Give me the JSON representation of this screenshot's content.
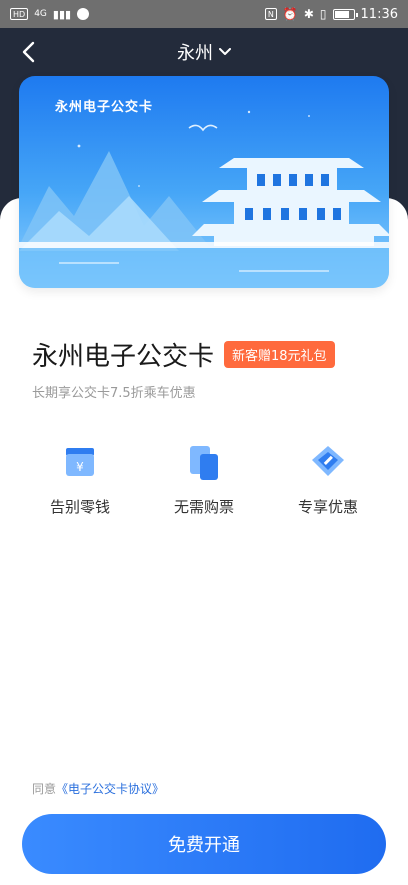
{
  "statusbar": {
    "left_badge": "HD",
    "network": "4G",
    "time": "11:36",
    "icons": [
      "nfc-icon",
      "alarm-icon",
      "bluetooth-icon",
      "vibrate-icon",
      "battery-icon"
    ]
  },
  "navbar": {
    "back_icon": "chevron-left-icon",
    "city": "永州",
    "dropdown_icon": "chevron-down-icon"
  },
  "card": {
    "title": "永州电子公交卡",
    "image": "pavilion-landscape-illustration"
  },
  "product": {
    "name": "永州电子公交卡",
    "badge": "新客赠18元礼包",
    "subtitle": "长期享公交卡7.5折乘车优惠"
  },
  "features": [
    {
      "label": "告别零钱",
      "icon": "wallet-yuan-icon"
    },
    {
      "label": "无需购票",
      "icon": "cards-icon"
    },
    {
      "label": "专享优惠",
      "icon": "coupon-tag-icon"
    }
  ],
  "agreement": {
    "prefix": "同意",
    "link": "《电子公交卡协议》"
  },
  "cta": {
    "label": "免费开通"
  },
  "colors": {
    "header_bg": "#232b3b",
    "accent": "#1f6cf0",
    "badge": "#ff6a3d"
  }
}
